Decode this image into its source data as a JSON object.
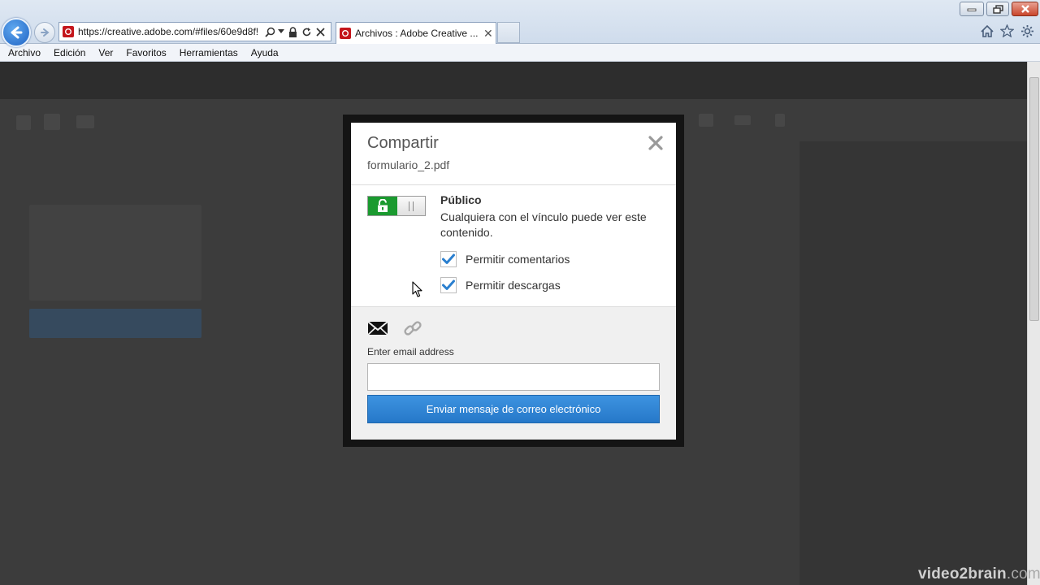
{
  "browser": {
    "address_url": "https://creative.adobe.com/#files/60e9d8f!",
    "tab_title": "Archivos : Adobe Creative ..."
  },
  "menubar": {
    "items": [
      "Archivo",
      "Edición",
      "Ver",
      "Favoritos",
      "Herramientas",
      "Ayuda"
    ]
  },
  "modal": {
    "title": "Compartir",
    "filename": "formulario_2.pdf",
    "visibility_label": "Público",
    "visibility_description": "Cualquiera con el vínculo puede ver este contenido.",
    "toggle_on": true,
    "checkboxes": [
      {
        "label": "Permitir comentarios",
        "checked": true
      },
      {
        "label": "Permitir descargas",
        "checked": true
      }
    ],
    "email_label": "Enter email address",
    "email_value": "",
    "send_button_label": "Enviar mensaje de correo electrónico"
  },
  "watermark": {
    "brand": "video2brain",
    "suffix": ".com"
  },
  "colors": {
    "toggle_green": "#1a9a2f",
    "button_blue": "#2e85d6",
    "check_blue": "#2a7fcf"
  }
}
